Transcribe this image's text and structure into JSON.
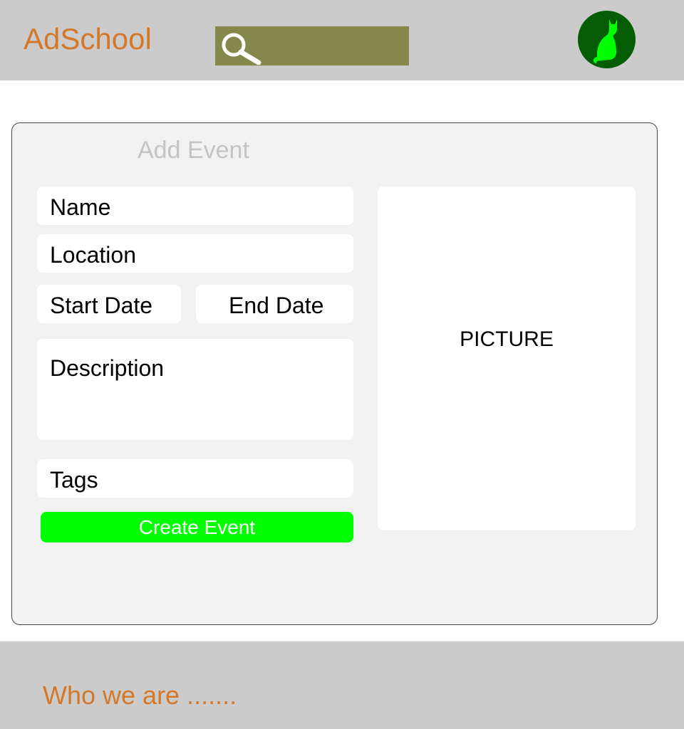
{
  "header": {
    "brand": "AdSchool",
    "search": {
      "value": "",
      "icon": "search-icon"
    },
    "avatar": {
      "icon": "cat-icon"
    }
  },
  "form": {
    "title": "Add Event",
    "fields": {
      "name": "Name",
      "location": "Location",
      "start_date": "Start Date",
      "end_date": "End Date",
      "description": "Description",
      "tags": "Tags"
    },
    "submit_label": "Create Event",
    "picture_label": "PICTURE"
  },
  "footer": {
    "link": "Who we are ......."
  },
  "colors": {
    "header_bg": "#cbcbcb",
    "brand": "#d4782a",
    "search_bg": "#84884b",
    "avatar_bg": "#045c04",
    "avatar_icon": "#00ff00",
    "card_bg": "#f2f2f2",
    "button": "#00ff00",
    "title_muted": "#c4c4c4"
  }
}
